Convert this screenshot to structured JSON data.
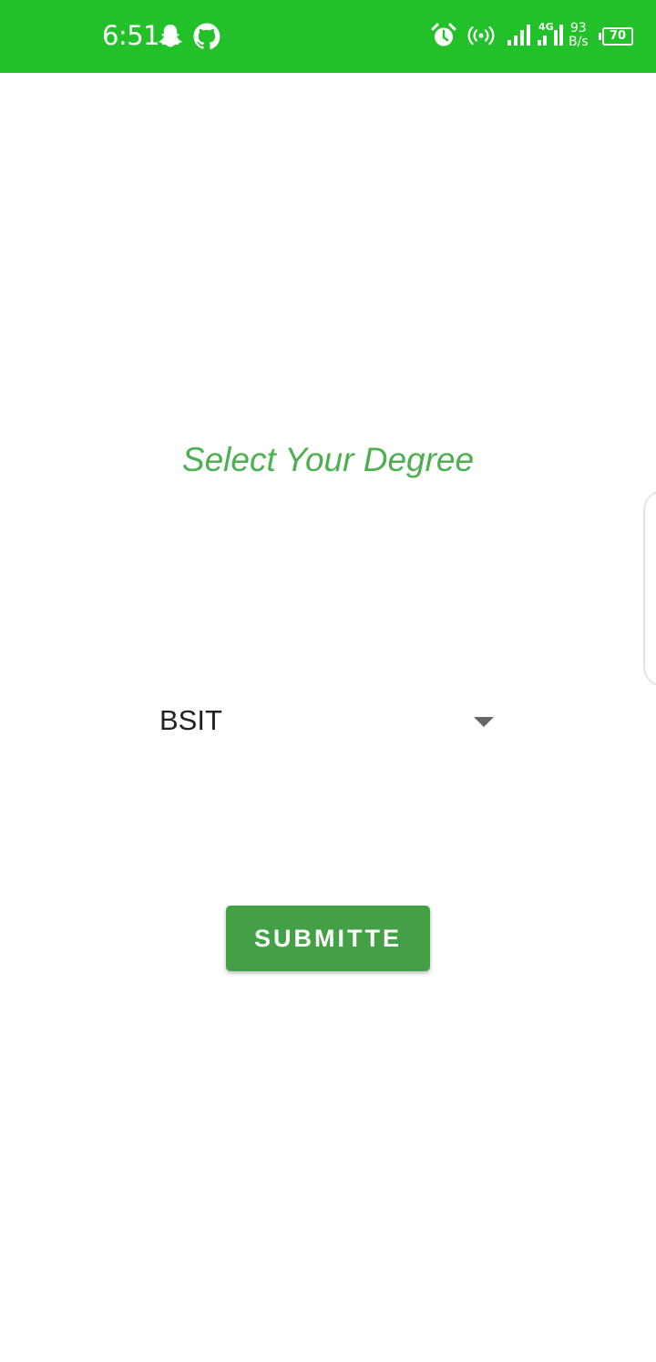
{
  "status_bar": {
    "time": "6:51",
    "net_speed_value": "93",
    "net_speed_unit": "B/s",
    "battery": "70",
    "network_type": "4G",
    "background_color": "#22c12a",
    "icons": [
      "snapchat-icon",
      "github-icon",
      "alarm-icon",
      "hotspot-icon",
      "signal-icon",
      "signal-4g-icon",
      "battery-icon"
    ]
  },
  "main": {
    "title": "Select Your Degree",
    "title_color": "#4caf50",
    "spinner": {
      "selected": "BSIT"
    },
    "submit_label": "SUBMITTE",
    "button_color": "#43a047"
  }
}
